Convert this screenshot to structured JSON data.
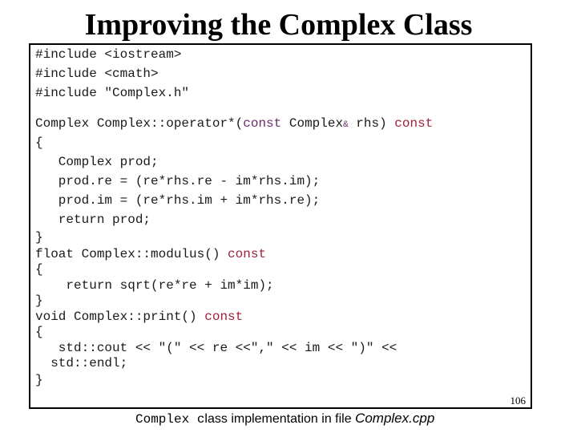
{
  "title": "Improving the Complex Class",
  "colors": {
    "param_const": "#6b2d6b",
    "trailing_const": "#a0203a"
  },
  "code": {
    "include1": "#include <iostream>",
    "include2": "#include <cmath>",
    "include3": "#include \"Complex.h\"",
    "op_sig_a": "Complex Complex::operator*(",
    "op_sig_const1": "const",
    "op_sig_b": " Complex",
    "op_sig_amp": "&",
    "op_sig_c": " rhs) ",
    "op_sig_const2": "const",
    "open1": "{",
    "body1": "   Complex prod;",
    "body2": "   prod.re = (re*rhs.re - im*rhs.im);",
    "body3": "   prod.im = (re*rhs.im + im*rhs.re);",
    "body4": "   return prod;",
    "close1": "}",
    "mod_sig": "float Complex::modulus() ",
    "mod_const": "const",
    "open2": "{",
    "mod_body": "    return sqrt(re*re + im*im);",
    "close2": "}",
    "print_sig": "void Complex::print() ",
    "print_const": "const",
    "open3": "{",
    "print_body1": "   std::cout << \"(\" << re <<\",\" << im << \")\" <<",
    "print_body2": "  std::endl;",
    "close3": "}"
  },
  "page_number": "106",
  "caption": {
    "mono_part": "Complex c",
    "sans_part": "lass implementation in file ",
    "italic_part": "Complex.cpp"
  }
}
